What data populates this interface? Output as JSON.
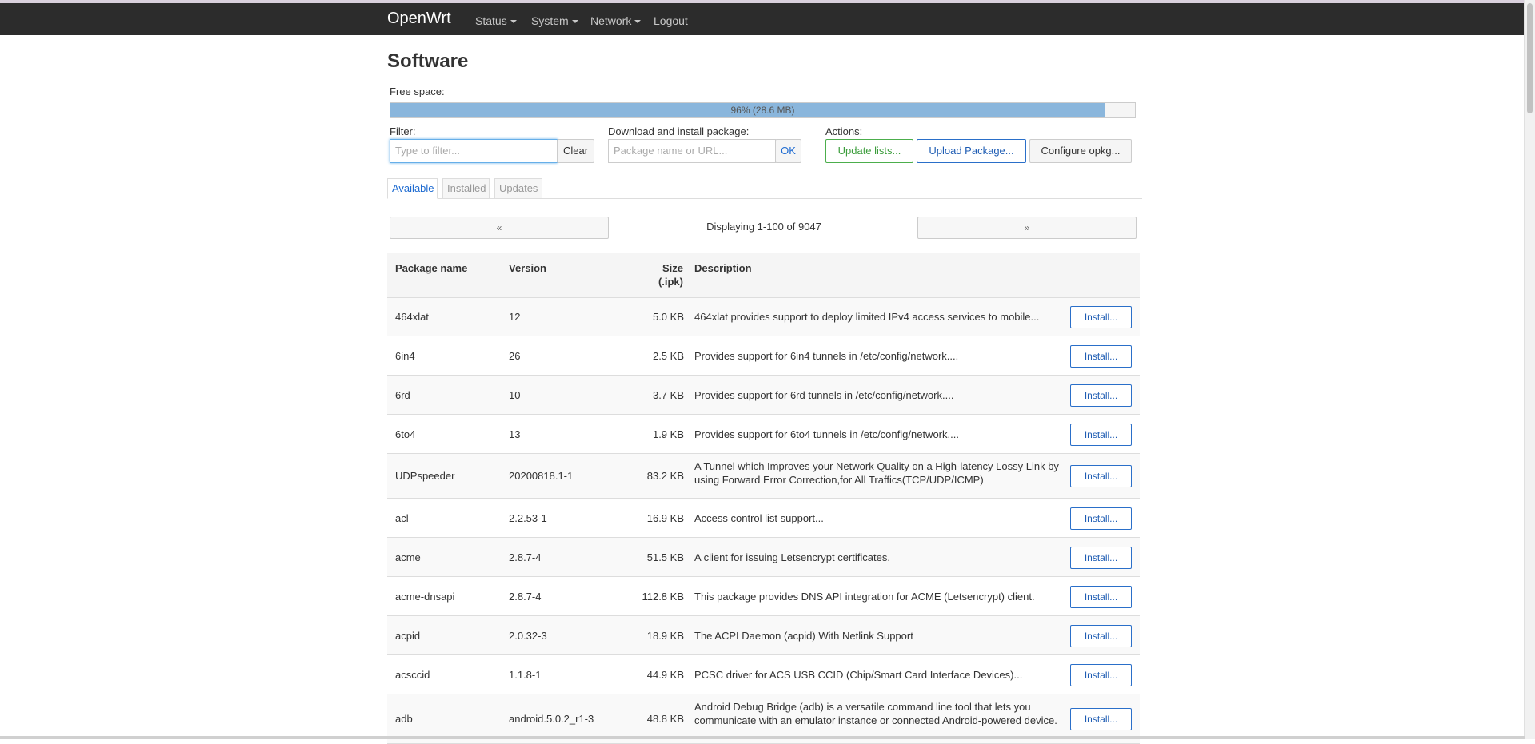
{
  "navbar": {
    "brand": "OpenWrt",
    "menu": [
      {
        "label": "Status"
      },
      {
        "label": "System"
      },
      {
        "label": "Network"
      },
      {
        "label": "Logout"
      }
    ]
  },
  "page": {
    "title": "Software",
    "free_space_label": "Free space:",
    "free_space_text": "96% (28.6 MB)",
    "free_space_percent": 96
  },
  "filter": {
    "label": "Filter:",
    "placeholder": "Type to filter...",
    "clear": "Clear"
  },
  "download": {
    "label": "Download and install package:",
    "placeholder": "Package name or URL...",
    "ok": "OK"
  },
  "actions": {
    "label": "Actions:",
    "update": "Update lists...",
    "upload": "Upload Package...",
    "configure": "Configure opkg..."
  },
  "tabs": [
    {
      "label": "Available"
    },
    {
      "label": "Installed"
    },
    {
      "label": "Updates"
    }
  ],
  "pager": {
    "prev": "«",
    "next": "»",
    "text": "Displaying 1-100 of 9047"
  },
  "table": {
    "headers": {
      "name": "Package name",
      "version": "Version",
      "size_line1": "Size",
      "size_line2": "(.ipk)",
      "description": "Description"
    },
    "install_label": "Install...",
    "rows": [
      {
        "name": "464xlat",
        "version": "12",
        "size": "5.0 KB",
        "desc": "464xlat provides support to deploy limited IPv4 access services to mobile..."
      },
      {
        "name": "6in4",
        "version": "26",
        "size": "2.5 KB",
        "desc": "Provides support for 6in4 tunnels in /etc/config/network...."
      },
      {
        "name": "6rd",
        "version": "10",
        "size": "3.7 KB",
        "desc": "Provides support for 6rd tunnels in /etc/config/network...."
      },
      {
        "name": "6to4",
        "version": "13",
        "size": "1.9 KB",
        "desc": "Provides support for 6to4 tunnels in /etc/config/network...."
      },
      {
        "name": "UDPspeeder",
        "version": "20200818.1-1",
        "size": "83.2 KB",
        "desc": "A Tunnel which Improves your Network Quality on a High-latency Lossy Link by using Forward Error Correction,for All Traffics(TCP/UDP/ICMP)"
      },
      {
        "name": "acl",
        "version": "2.2.53-1",
        "size": "16.9 KB",
        "desc": "Access control list support..."
      },
      {
        "name": "acme",
        "version": "2.8.7-4",
        "size": "51.5 KB",
        "desc": "A client for issuing Letsencrypt certificates."
      },
      {
        "name": "acme-dnsapi",
        "version": "2.8.7-4",
        "size": "112.8 KB",
        "desc": "This package provides DNS API integration for ACME (Letsencrypt) client."
      },
      {
        "name": "acpid",
        "version": "2.0.32-3",
        "size": "18.9 KB",
        "desc": "The ACPI Daemon (acpid) With Netlink Support"
      },
      {
        "name": "acsccid",
        "version": "1.1.8-1",
        "size": "44.9 KB",
        "desc": "PCSC driver for ACS USB CCID (Chip/Smart Card Interface Devices)..."
      },
      {
        "name": "adb",
        "version": "android.5.0.2_r1-3",
        "size": "48.8 KB",
        "desc": "Android Debug Bridge (adb) is a versatile command line tool that lets you communicate with an emulator instance or connected Android-powered device."
      }
    ]
  }
}
